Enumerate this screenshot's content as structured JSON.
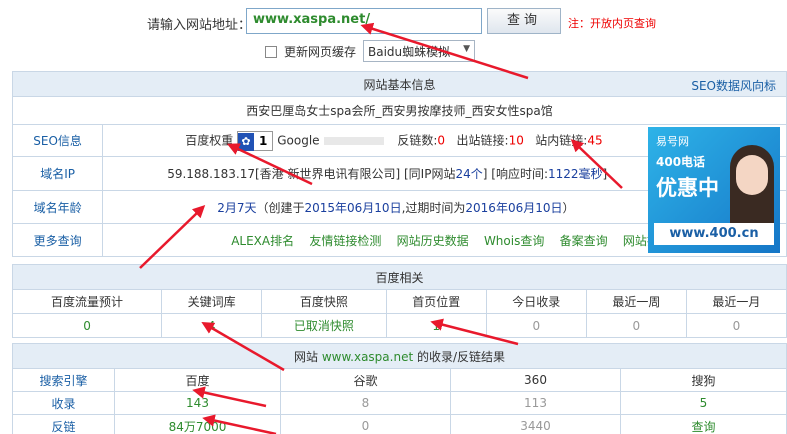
{
  "query": {
    "label": "请输入网站地址：",
    "url_value": "www.xaspa.net/",
    "button": "查询",
    "notice": "注：开放内页查询",
    "cache_label": "更新网页缓存",
    "engine_selected": "Baidu蜘蛛模拟"
  },
  "basic": {
    "header": "网站基本信息",
    "seo_link": "SEO数据风向标",
    "site_title": "西安巴厘岛女士spa会所_西安男按摩技师_西安女性spa馆",
    "seo_label": "SEO信息",
    "baidu_weight_label": "百度权重",
    "baidu_weight_icon": "paw-icon",
    "baidu_weight_value": "1",
    "google_label": "Google",
    "backlinks_label": "反链数:",
    "backlinks_value": "0",
    "outbound_label": "出站链接:",
    "outbound_value": "10",
    "internal_label": "站内链接:",
    "internal_value": "45",
    "ip_label": "域名IP",
    "ip_text": "59.188.183.17[香港 新世界电讯有限公司]",
    "same_ip_prefix": "[同IP网站",
    "same_ip_count": "24个",
    "same_ip_suffix": "]",
    "response_prefix": "[响应时间:",
    "response_value": "1122毫秒",
    "response_suffix": "]",
    "age_label": "域名年龄",
    "age_value": "2月7天",
    "age_created_prefix": "（创建于",
    "age_created": "2015年06月10日",
    "age_expire_prefix": ",过期时间为",
    "age_expire": "2016年06月10日",
    "age_suffix": "）",
    "more_label": "更多查询",
    "more_links": [
      "ALEXA排名",
      "友情链接检测",
      "网站历史数据",
      "Whois查询",
      "备案查询",
      "网站排名"
    ]
  },
  "ad": {
    "brand": "易号网",
    "tel": "400电话",
    "offer": "优惠中",
    "url": "www.400.cn"
  },
  "baidu": {
    "header": "百度相关",
    "columns": [
      "百度流量预计",
      "关键词库",
      "百度快照",
      "首页位置",
      "今日收录",
      "最近一周",
      "最近一月"
    ],
    "values": [
      "0",
      "4",
      "已取消快照",
      "1",
      "0",
      "0",
      "0"
    ]
  },
  "results": {
    "header_prefix": "网站",
    "header_domain": "www.xaspa.net",
    "header_suffix": "的收录/反链结果",
    "columns": [
      "搜索引擎",
      "百度",
      "谷歌",
      "360",
      "搜狗"
    ],
    "rows": [
      {
        "label": "收录",
        "values": [
          "143",
          "8",
          "113",
          "5"
        ]
      },
      {
        "label": "反链",
        "values": [
          "84万7000",
          "0",
          "3440",
          "查询"
        ]
      }
    ]
  },
  "colors": {
    "accent_blue": "#1a5fa5",
    "green": "#2e8b2e",
    "red": "#e00000",
    "header_bg": "#e4edf6",
    "border": "#c9d7e6",
    "arrow": "#e8192c"
  }
}
